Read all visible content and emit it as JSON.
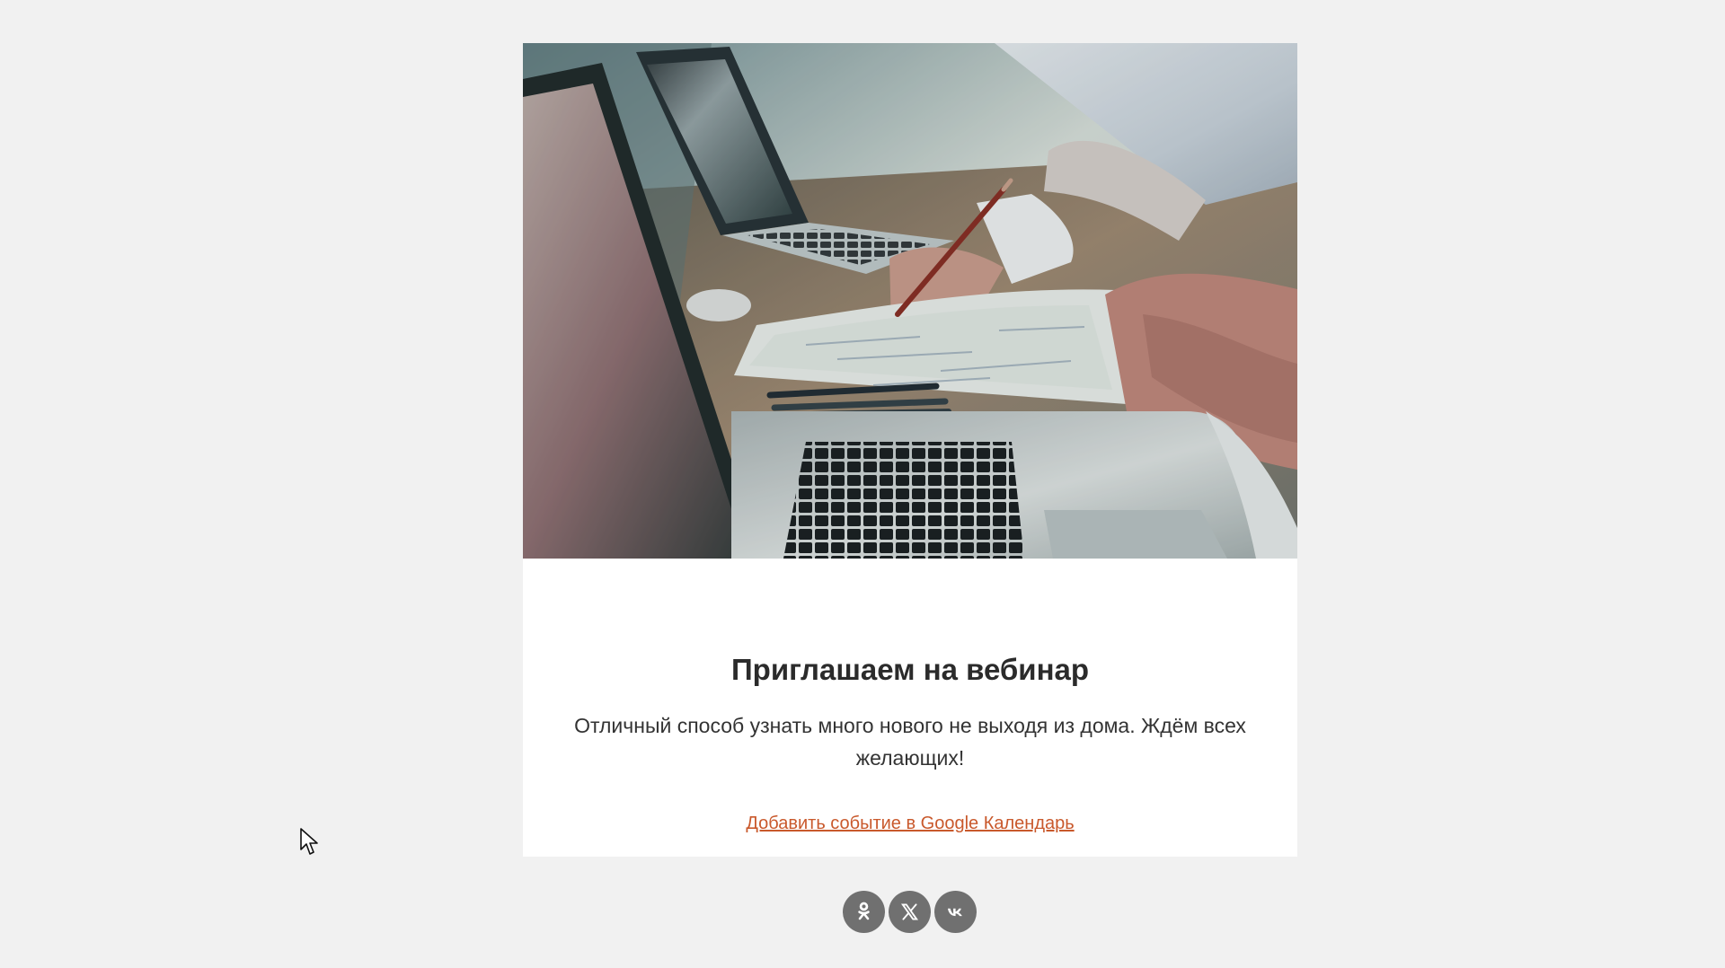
{
  "email": {
    "title": "Приглашаем на вебинар",
    "description": "Отличный способ узнать много нового не выходя из дома. Ждём всех желающих!",
    "calendar_link": "Добавить событие в Google Календарь"
  },
  "hero": {
    "subject": "laptops, notebook and hands with pencil on desk"
  },
  "social": [
    {
      "name": "ok-icon"
    },
    {
      "name": "x-icon"
    },
    {
      "name": "vk-icon"
    }
  ],
  "colors": {
    "page_background": "#f1f1f1",
    "card_background": "#ffffff",
    "title_text": "#2b2b2b",
    "body_text": "#333333",
    "link": "#c9592c",
    "social_button": "#707070"
  }
}
